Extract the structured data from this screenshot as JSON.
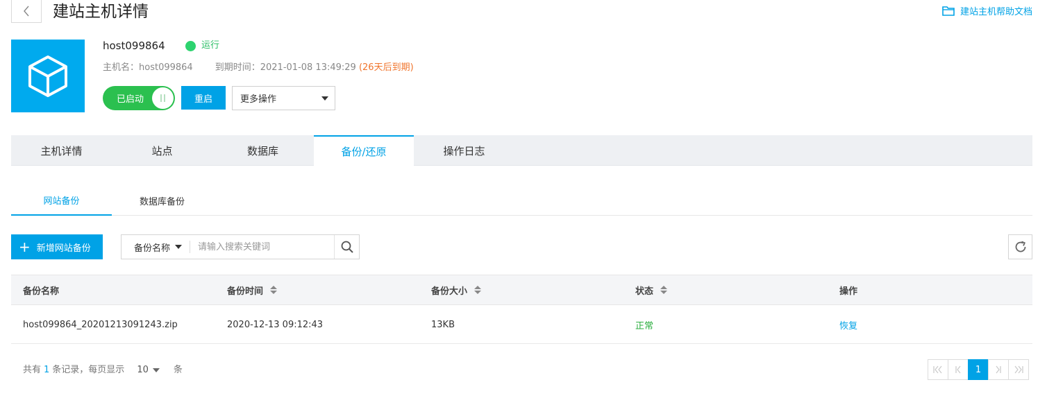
{
  "header": {
    "title": "建站主机详情",
    "back_icon": "chevron-left-icon",
    "help_label": "建站主机帮助文档",
    "help_icon": "folder-icon"
  },
  "host": {
    "name": "host099864",
    "status": "运行",
    "status_color": "#2dd36f",
    "hostname_label": "主机名：",
    "hostname": "host099864",
    "expire_label": "到期时间：",
    "expire_time": "2021-01-08 13:49:29",
    "expire_note": "(26天后到期)",
    "icon": "cube-icon",
    "toggle_label": "已启动",
    "restart_label": "重启",
    "more_ops_label": "更多操作"
  },
  "main_tabs": [
    {
      "label": "主机详情"
    },
    {
      "label": "站点"
    },
    {
      "label": "数据库"
    },
    {
      "label": "备份/还原"
    },
    {
      "label": "操作日志"
    }
  ],
  "sub_tabs": [
    {
      "label": "网站备份"
    },
    {
      "label": "数据库备份"
    }
  ],
  "toolbar": {
    "add_label": "新增网站备份",
    "search_type": "备份名称",
    "search_placeholder": "请输入搜索关键词"
  },
  "table": {
    "headers": [
      "备份名称",
      "备份时间",
      "备份大小",
      "状态",
      "操作"
    ],
    "rows": [
      {
        "name": "host099864_20201213091243.zip",
        "time": "2020-12-13 09:12:43",
        "size": "13KB",
        "status": "正常",
        "action": "恢复"
      }
    ]
  },
  "pagination": {
    "prefix": "共有",
    "total": "1",
    "middle": "条记录，每页显示",
    "page_size": "10",
    "suffix": "条",
    "current_page": "1"
  },
  "colors": {
    "accent": "#00a2e6",
    "success": "#2bc04f",
    "warning": "#f0752d"
  }
}
